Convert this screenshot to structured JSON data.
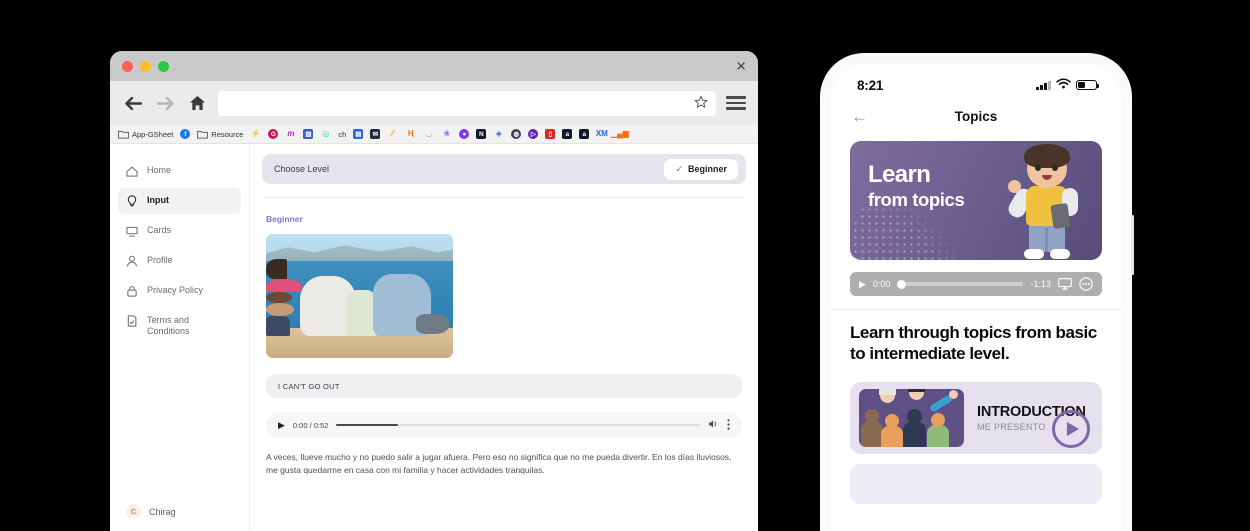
{
  "browser": {
    "window_controls": [
      "close",
      "minimize",
      "maximize"
    ],
    "close_label": "×",
    "nav": {
      "back": "back-arrow",
      "forward": "forward-arrow",
      "home": "home-icon",
      "url_value": "",
      "url_placeholder": "",
      "star": "☆",
      "menu": "hamburger-menu"
    },
    "bookmarks": [
      {
        "label": "App-GSheet",
        "icon": "folder",
        "color": "#5f6368"
      },
      {
        "label": "",
        "icon": "facebook",
        "color": "#1877f2"
      },
      {
        "label": "Resource",
        "icon": "folder",
        "color": "#5f6368"
      },
      {
        "label": "",
        "icon": "bolt",
        "color": "#ef4444"
      },
      {
        "label": "",
        "icon": "g-circle",
        "color": "#c2185b"
      },
      {
        "label": "",
        "icon": "m-logo",
        "color": "#c026d3"
      },
      {
        "label": "",
        "icon": "analytics",
        "color": "#3b5bdb"
      },
      {
        "label": "",
        "icon": "c-circle",
        "color": "#2dd4bf"
      },
      {
        "label": "ch",
        "icon": "text",
        "color": "#333333"
      },
      {
        "label": "",
        "icon": "grid-blue",
        "color": "#2563eb"
      },
      {
        "label": "",
        "icon": "mail",
        "color": "#1f2937"
      },
      {
        "label": "",
        "icon": "slash",
        "color": "#f59e0b"
      },
      {
        "label": "",
        "icon": "m-orange",
        "color": "#f97316"
      },
      {
        "label": "",
        "icon": "swirl",
        "color": "#9ca3af"
      },
      {
        "label": "",
        "icon": "atom",
        "color": "#a855f7"
      },
      {
        "label": "",
        "icon": "circle-purple",
        "color": "#7c3aed"
      },
      {
        "label": "",
        "icon": "notion",
        "color": "#111827"
      },
      {
        "label": "",
        "icon": "diamond",
        "color": "#2563eb"
      },
      {
        "label": "",
        "icon": "globe",
        "color": "#374151"
      },
      {
        "label": "",
        "icon": "play-badge",
        "color": "#5b21b6"
      },
      {
        "label": "",
        "icon": "phone",
        "color": "#dc2626"
      },
      {
        "label": "",
        "icon": "a-dark",
        "color": "#111827"
      },
      {
        "label": "",
        "icon": "amazon",
        "color": "#111827"
      },
      {
        "label": "XM",
        "icon": "xm",
        "color": "#2563eb"
      },
      {
        "label": "",
        "icon": "bar-chart",
        "color": "#f97316"
      }
    ],
    "sidebar": {
      "items": [
        {
          "label": "Home",
          "icon": "home-icon",
          "active": false
        },
        {
          "label": "Input",
          "icon": "bulb-icon",
          "active": true
        },
        {
          "label": "Cards",
          "icon": "monitor-icon",
          "active": false
        },
        {
          "label": "Profile",
          "icon": "person-icon",
          "active": false
        },
        {
          "label": "Privacy Policy",
          "icon": "lock-icon",
          "active": false
        },
        {
          "label": "Terms and Conditions",
          "icon": "document-check-icon",
          "active": false
        }
      ],
      "user": {
        "name": "Chirag",
        "initial": "C"
      }
    },
    "content": {
      "choose_level_label": "Choose Level",
      "level_pill": {
        "label": "Beginner",
        "check": "✓"
      },
      "section_label": "Beginner",
      "photo_alt": "family-photo",
      "caption": "I CAN'T GO OUT",
      "audio": {
        "play": "▶",
        "time": "0:00 / 0:52",
        "progress_percent": 17,
        "volume_icon": "volume-icon",
        "more_icon": "kebab-menu-icon"
      },
      "paragraph": "A veces, llueve mucho y no puedo salir a jugar afuera. Pero eso no significa que no me pueda divertir. En los días lluviosos, me gusta quedarme en casa con mi familia y hacer actividades tranquilas."
    }
  },
  "phone": {
    "status": {
      "time": "8:21",
      "signal": "signal-bars",
      "wifi": "wifi-icon",
      "battery": "battery-icon"
    },
    "header": {
      "back": "←",
      "title": "Topics"
    },
    "banner": {
      "line1": "Learn",
      "line2": "from topics",
      "character": "3d-boy-character"
    },
    "audio": {
      "play": "▶",
      "current_time": "0:00",
      "remaining_time": "-1:13",
      "progress_percent": 0,
      "airplay_icon": "airplay-icon",
      "more_icon": "more-circle-icon"
    },
    "heading": "Learn through topics from basic to intermediate level.",
    "topics": [
      {
        "title": "INTRODUCTION",
        "subtitle": "ME PRESENTO",
        "thumb": "group-people-illustration",
        "play": "play-icon"
      }
    ]
  },
  "colors": {
    "accent_purple": "#7a68a8",
    "banner_purple": "#6d6090",
    "card_lavender": "#e4e0ee",
    "level_bar": "#e6e4ec",
    "beginner_label": "#7b78c4"
  }
}
